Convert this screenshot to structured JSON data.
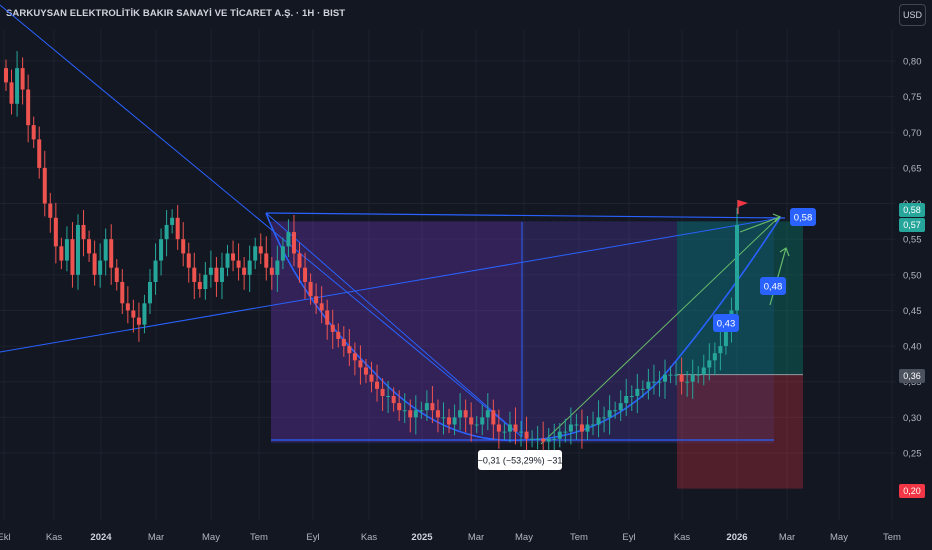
{
  "header": {
    "title": "SARKUYSAN ELEKTROLİTİK BAKIR SANAYİ VE TİCARET A.Ş. · 1H · BIST",
    "currency_button": "USD"
  },
  "colors": {
    "background": "#131722",
    "up": "#26a69a",
    "down": "#ef5350",
    "drawing_blue": "#2962ff",
    "drawing_green": "#66bb6a",
    "grid": "#1e222d",
    "text": "#b2b5be"
  },
  "chart_data": {
    "type": "candlestick",
    "title": "SARKUYSAN ELEKTROLİTİK BAKIR SANAYİ VE TİCARET A.Ş. · 1H · BIST",
    "currency": "USD",
    "ylim": [
      0.19,
      0.84
    ],
    "y_ticks": [
      "0,80",
      "0,75",
      "0,70",
      "0,65",
      "0,60",
      "0,55",
      "0,50",
      "0,45",
      "0,40",
      "0,35",
      "0,30",
      "0,25"
    ],
    "x_ticks": [
      "Ekl",
      "Kas",
      "2024",
      "Mar",
      "May",
      "Tem",
      "Eyl",
      "Kas",
      "2025",
      "Mar",
      "May",
      "Tem",
      "Eyl",
      "Kas",
      "2026",
      "Mar",
      "May",
      "Tem"
    ],
    "price_labels": [
      {
        "text": "0,58",
        "value": 0.583,
        "color": "#26a69a"
      },
      {
        "text": "0,57",
        "value": 0.57,
        "color": "#26a69a"
      },
      {
        "text": "0,36",
        "value": 0.36,
        "color": "#4c525e"
      },
      {
        "text": "0,20",
        "value": 0.2,
        "color": "#f23645"
      }
    ],
    "measure_label": "−0,31 (−53,29%) −31",
    "target_labels": [
      {
        "text": "0,43",
        "value": 0.43
      },
      {
        "text": "0,48",
        "value": 0.48
      },
      {
        "text": "0,58",
        "value": 0.58
      }
    ],
    "cup_pattern": {
      "rim": 0.575,
      "bottom": 0.265,
      "left_date": "2024-07",
      "right_date": "2026-02"
    },
    "long_position": {
      "entry": 0.36,
      "stop": 0.2,
      "target": 0.575
    },
    "series": [
      {
        "name": "close",
        "values": [
          0.77,
          0.74,
          0.79,
          0.76,
          0.71,
          0.69,
          0.65,
          0.6,
          0.58,
          0.54,
          0.52,
          0.55,
          0.5,
          0.57,
          0.55,
          0.53,
          0.5,
          0.52,
          0.55,
          0.51,
          0.49,
          0.46,
          0.45,
          0.44,
          0.43,
          0.46,
          0.49,
          0.52,
          0.55,
          0.57,
          0.58,
          0.55,
          0.53,
          0.51,
          0.49,
          0.48,
          0.5,
          0.51,
          0.49,
          0.51,
          0.53,
          0.52,
          0.51,
          0.5,
          0.52,
          0.54,
          0.53,
          0.51,
          0.5,
          0.52,
          0.54,
          0.56,
          0.53,
          0.51,
          0.49,
          0.47,
          0.46,
          0.45,
          0.43,
          0.42,
          0.41,
          0.4,
          0.39,
          0.38,
          0.37,
          0.36,
          0.35,
          0.34,
          0.33,
          0.33,
          0.32,
          0.31,
          0.31,
          0.3,
          0.31,
          0.31,
          0.32,
          0.31,
          0.3,
          0.3,
          0.29,
          0.3,
          0.31,
          0.3,
          0.29,
          0.29,
          0.3,
          0.31,
          0.29,
          0.28,
          0.28,
          0.29,
          0.28,
          0.28,
          0.27,
          0.27,
          0.27,
          0.266,
          0.27,
          0.27,
          0.28,
          0.28,
          0.29,
          0.29,
          0.28,
          0.29,
          0.29,
          0.3,
          0.3,
          0.31,
          0.31,
          0.32,
          0.33,
          0.33,
          0.34,
          0.34,
          0.35,
          0.35,
          0.35,
          0.36,
          0.36,
          0.36,
          0.35,
          0.35,
          0.36,
          0.36,
          0.37,
          0.38,
          0.39,
          0.4,
          0.42,
          0.45,
          0.57
        ]
      }
    ]
  }
}
